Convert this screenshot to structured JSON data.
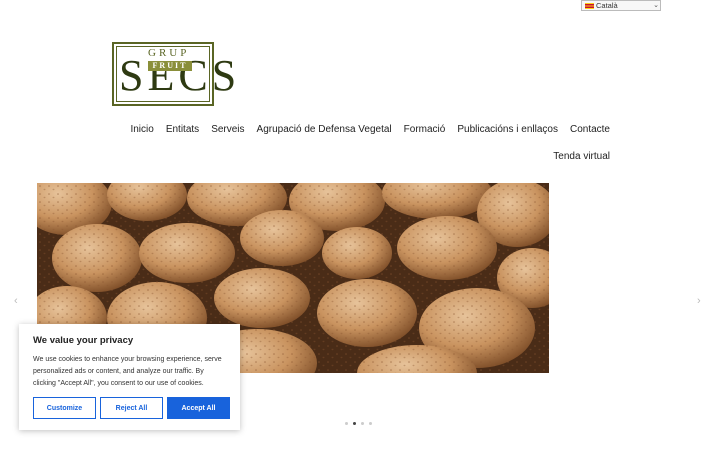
{
  "language_selector": {
    "selected": "Català",
    "flag_icon": "catalan-flag-icon"
  },
  "logo": {
    "line1": "GRUP",
    "line2": "FRUIT",
    "line3": "SECS"
  },
  "nav": {
    "items": [
      "Inicio",
      "Entitats",
      "Serveis",
      "Agrupació de Defensa Vegetal",
      "Formació",
      "Publicacións i enllaços",
      "Contacte"
    ],
    "second_row": "Tenda virtual"
  },
  "slider": {
    "prev_icon": "‹",
    "next_icon": "›",
    "dots": 4,
    "active_dot": 1
  },
  "cookie_banner": {
    "title": "We value your privacy",
    "text": "We use cookies to enhance your browsing experience, serve personalized ads or content, and analyze our traffic. By clicking \"Accept All\", you consent to our use of cookies.",
    "customize_label": "Customize",
    "reject_label": "Reject All",
    "accept_label": "Accept All",
    "accent_color": "#1863dc"
  }
}
